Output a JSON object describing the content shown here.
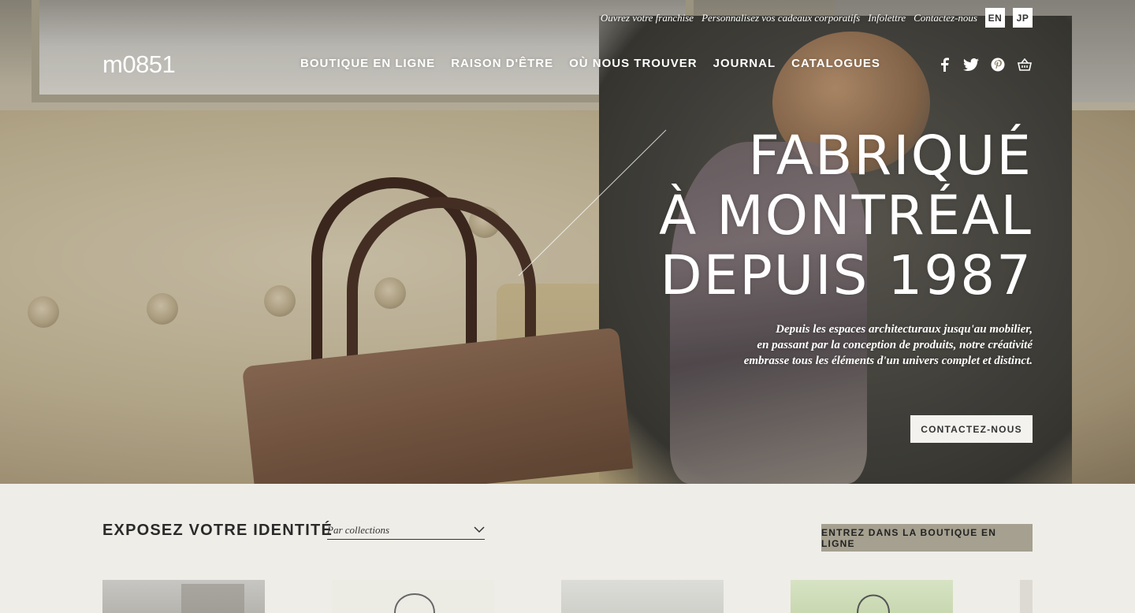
{
  "brand": {
    "logo": "m0851"
  },
  "util_nav": {
    "links": [
      "Ouvrez votre franchise",
      "Personnalisez vos cadeaux corporatifs",
      "Infolettre",
      "Contactez-nous"
    ],
    "languages": [
      "EN",
      "JP"
    ]
  },
  "main_nav": [
    "BOUTIQUE EN LIGNE",
    "RAISON D'ÊTRE",
    "OÙ NOUS TROUVER",
    "JOURNAL",
    "CATALOGUES"
  ],
  "social_icons": [
    "facebook-icon",
    "twitter-icon",
    "pinterest-icon",
    "basket-icon"
  ],
  "hero": {
    "headline": [
      "FABRIQUÉ",
      "À MONTRÉAL",
      "DEPUIS 1987"
    ],
    "tagline": [
      "Depuis les espaces architecturaux jusqu'au mobilier,",
      "en passant par la conception de produits, notre créativité",
      "embrasse tous les éléments d'un univers complet et distinct."
    ],
    "cta": "CONTACTEZ-NOUS"
  },
  "section": {
    "title": "EXPOSEZ VOTRE IDENTITÉ",
    "filter_value": "Par collections",
    "shop_button": "ENTREZ DANS LA BOUTIQUE EN LIGNE"
  },
  "colors": {
    "background": "#efede8",
    "button_bg": "#a5a08f",
    "text_dark": "#2a2a2a"
  }
}
